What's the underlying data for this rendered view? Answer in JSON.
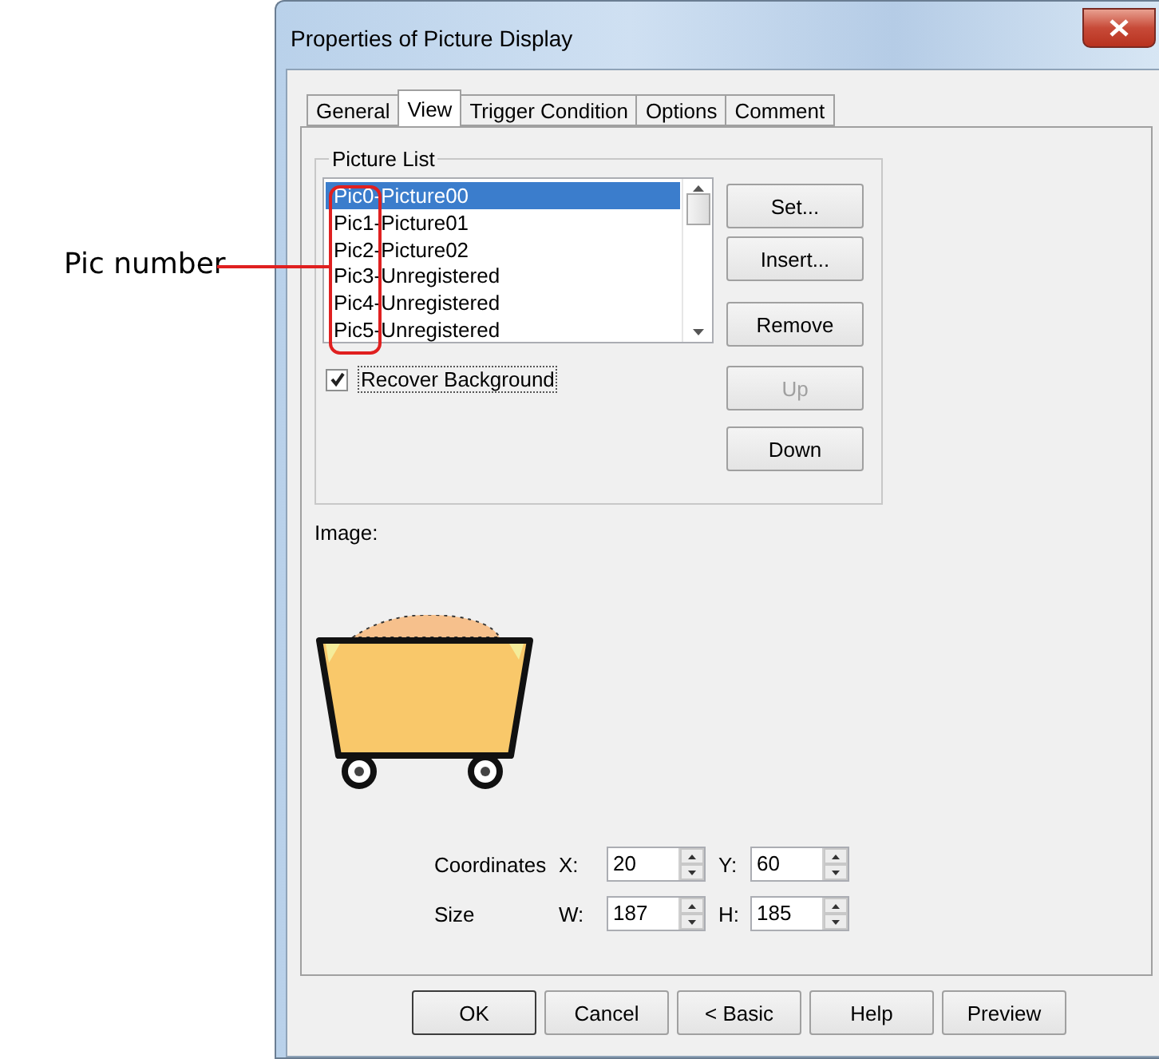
{
  "window": {
    "title": "Properties of Picture Display"
  },
  "tabs": [
    {
      "label": "General",
      "selected": false
    },
    {
      "label": "View",
      "selected": true
    },
    {
      "label": "Trigger Condition",
      "selected": false
    },
    {
      "label": "Options",
      "selected": false
    },
    {
      "label": "Comment",
      "selected": false
    }
  ],
  "picture_list": {
    "label": "Picture List",
    "items": [
      {
        "text": "Pic0-Picture00",
        "selected": true
      },
      {
        "text": "Pic1-Picture01",
        "selected": false
      },
      {
        "text": "Pic2-Picture02",
        "selected": false
      },
      {
        "text": "Pic3-Unregistered",
        "selected": false
      },
      {
        "text": "Pic4-Unregistered",
        "selected": false
      },
      {
        "text": "Pic5-Unregistered",
        "selected": false
      }
    ],
    "recover_background": {
      "label": "Recover Background",
      "checked": true
    }
  },
  "list_buttons": [
    {
      "label": "Set...",
      "disabled": false
    },
    {
      "label": "Insert...",
      "disabled": false
    },
    {
      "label": "Remove",
      "disabled": false
    },
    {
      "label": "Up",
      "disabled": true
    },
    {
      "label": "Down",
      "disabled": false
    }
  ],
  "image": {
    "label": "Image:"
  },
  "coordinates": {
    "label": "Coordinates",
    "fields": [
      {
        "label": "X:",
        "value": "20"
      },
      {
        "label": "Y:",
        "value": "60"
      }
    ]
  },
  "size": {
    "label": "Size",
    "fields": [
      {
        "label": "W:",
        "value": "187"
      },
      {
        "label": "H:",
        "value": "185"
      }
    ]
  },
  "buttons": [
    {
      "label": "OK",
      "default": true
    },
    {
      "label": "Cancel",
      "default": false
    },
    {
      "label": "< Basic",
      "default": false
    },
    {
      "label": "Help",
      "default": false
    },
    {
      "label": "Preview",
      "default": false
    }
  ],
  "annotation": {
    "label": "Pic number"
  }
}
